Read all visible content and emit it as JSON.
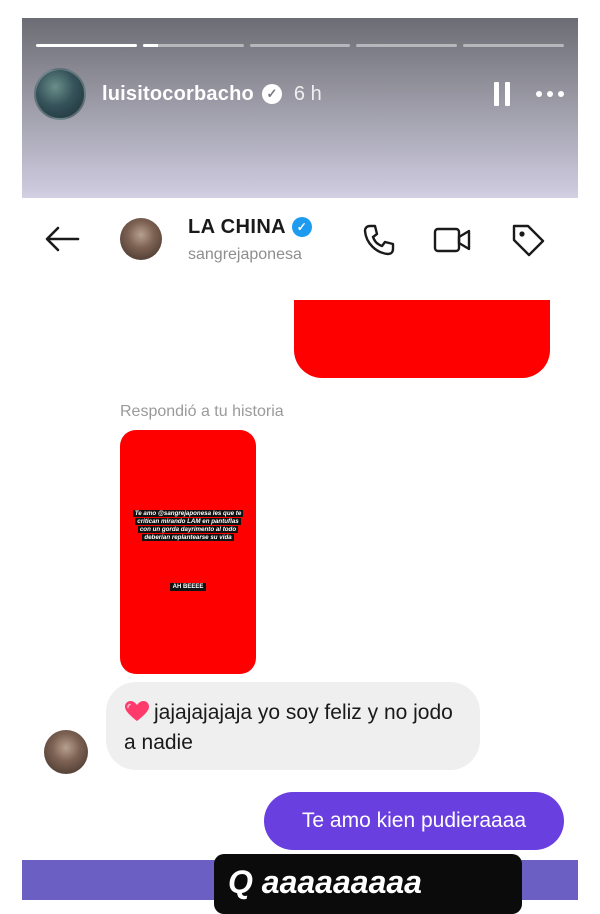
{
  "story": {
    "progress": [
      1.0,
      0.15,
      0,
      0,
      0
    ],
    "username": "luisitocorbacho",
    "time": "6 h",
    "caption": "Q aaaaaaaaa"
  },
  "dm": {
    "name": "LA CHINA",
    "username": "sangrejaponesa",
    "replied_label": "Respondió a tu historia",
    "story_text": "Te amo @sangrejaponesa les que te critican mirando LAM en pantuflas con un gorda dayrimento al todo deberían replantearse su vida",
    "story_subtext": "AH BEEEE",
    "received_message": "jajajajajaja yo soy feliz y no jodo a nadie",
    "sent_message": "Te amo kien pudieraaaa"
  },
  "colors": {
    "accent_purple": "#6a3fe0",
    "story_red": "#ff0000",
    "verified_blue": "#1d9bf0",
    "bottom_band": "#6b5fc3"
  },
  "icons": [
    "pause-icon",
    "more-icon",
    "back-arrow-icon",
    "phone-icon",
    "video-icon",
    "tag-icon",
    "heart-icon"
  ]
}
